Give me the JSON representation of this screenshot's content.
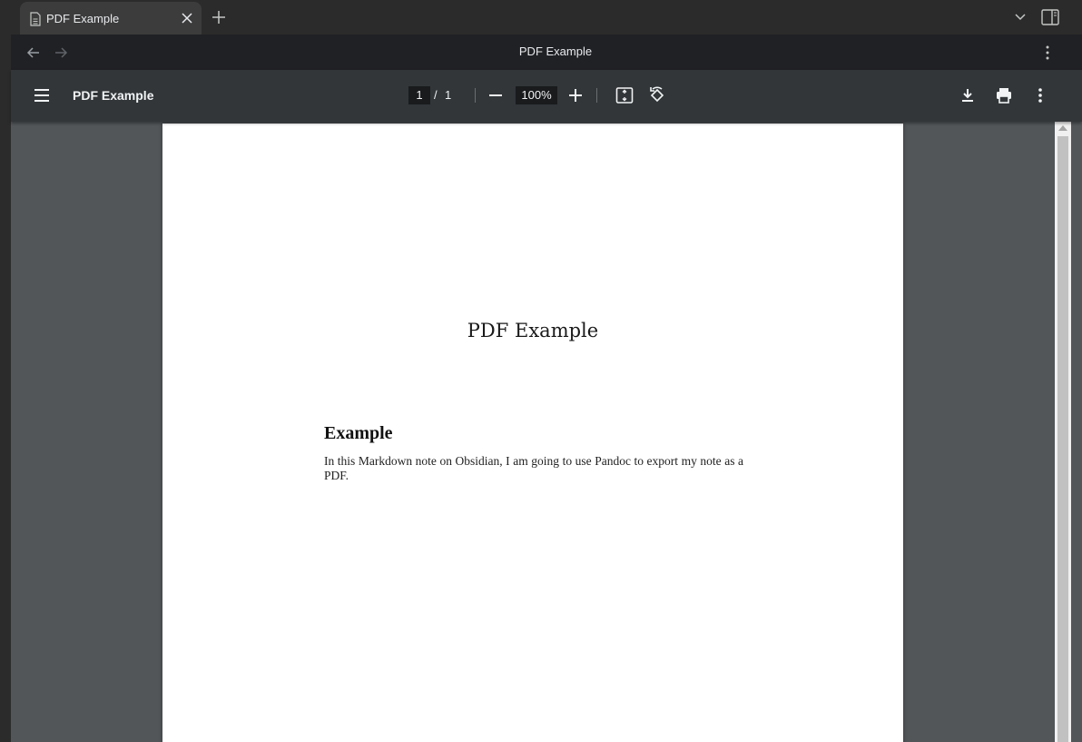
{
  "browser": {
    "tab_title": "PDF Example",
    "page_heading": "PDF Example"
  },
  "pdf_toolbar": {
    "document_title": "PDF Example",
    "current_page": "1",
    "separator": "/",
    "total_pages": "1",
    "zoom": "100%"
  },
  "pdf_content": {
    "title": "PDF Example",
    "heading": "Example",
    "paragraph": "In this Markdown note on Obsidian, I am going to use Pandoc to export my note as a PDF."
  },
  "icons": {
    "tab": [
      "document-icon",
      "close-icon"
    ],
    "tabstrip": [
      "new-tab-icon",
      "tab-search-chevron-icon",
      "side-panel-icon"
    ],
    "nav": [
      "back-arrow-icon",
      "forward-arrow-icon",
      "kebab-menu-icon"
    ],
    "pdf": [
      "hamburger-menu-icon",
      "zoom-out-icon",
      "zoom-in-icon",
      "fit-to-page-icon",
      "rotate-icon",
      "download-icon",
      "print-icon",
      "more-options-icon"
    ]
  },
  "colors": {
    "tabstrip_bg": "#2b2b2b",
    "tab_bg": "#3c3c3c",
    "header_bg": "#202124",
    "pdf_toolbar_bg": "#323639",
    "viewer_bg": "#525659",
    "page_bg": "#ffffff"
  }
}
